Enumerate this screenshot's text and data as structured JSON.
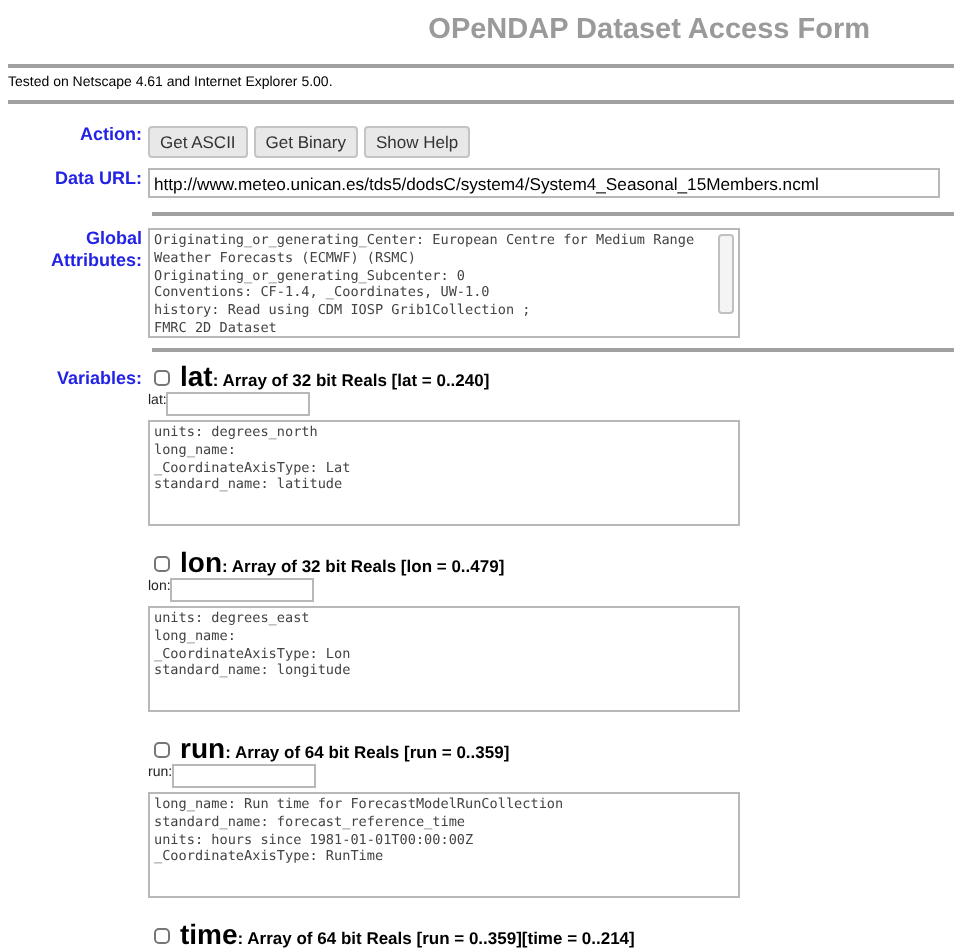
{
  "title": "OPeNDAP Dataset Access Form",
  "note": "Tested on Netscape 4.61 and Internet Explorer 5.00.",
  "action": {
    "label": "Action:",
    "buttons": [
      "Get ASCII",
      "Get Binary",
      "Show Help"
    ]
  },
  "data_url": {
    "label": "Data URL:",
    "value": "http://www.meteo.unican.es/tds5/dodsC/system4/System4_Seasonal_15Members.ncml"
  },
  "global_attributes": {
    "label": "Global Attributes:",
    "text": "Originating_or_generating_Center: European Centre for Medium Range\nWeather Forecasts (ECMWF) (RSMC)\nOriginating_or_generating_Subcenter: 0\nConventions: CF-1.4, _Coordinates, UW-1.0\nhistory: Read using CDM IOSP Grib1Collection ;\nFMRC 2D Dataset"
  },
  "variables_label": "Variables:",
  "variables": [
    {
      "name": "lat",
      "description": ": Array of 32 bit Reals [lat = 0..240]",
      "checked": false,
      "constraint_label": "lat:",
      "attributes": "units: degrees_north\nlong_name:\n_CoordinateAxisType: Lat\nstandard_name: latitude"
    },
    {
      "name": "lon",
      "description": ": Array of 32 bit Reals [lon = 0..479]",
      "checked": false,
      "constraint_label": "lon:",
      "attributes": "units: degrees_east\nlong_name:\n_CoordinateAxisType: Lon\nstandard_name: longitude"
    },
    {
      "name": "run",
      "description": ": Array of 64 bit Reals [run = 0..359]",
      "checked": false,
      "constraint_label": "run:",
      "attributes": "long_name: Run time for ForecastModelRunCollection\nstandard_name: forecast_reference_time\nunits: hours since 1981-01-01T00:00:00Z\n_CoordinateAxisType: RunTime"
    },
    {
      "name": "time",
      "description": ": Array of 64 bit Reals [run = 0..359][time = 0..214]",
      "checked": false
    }
  ]
}
